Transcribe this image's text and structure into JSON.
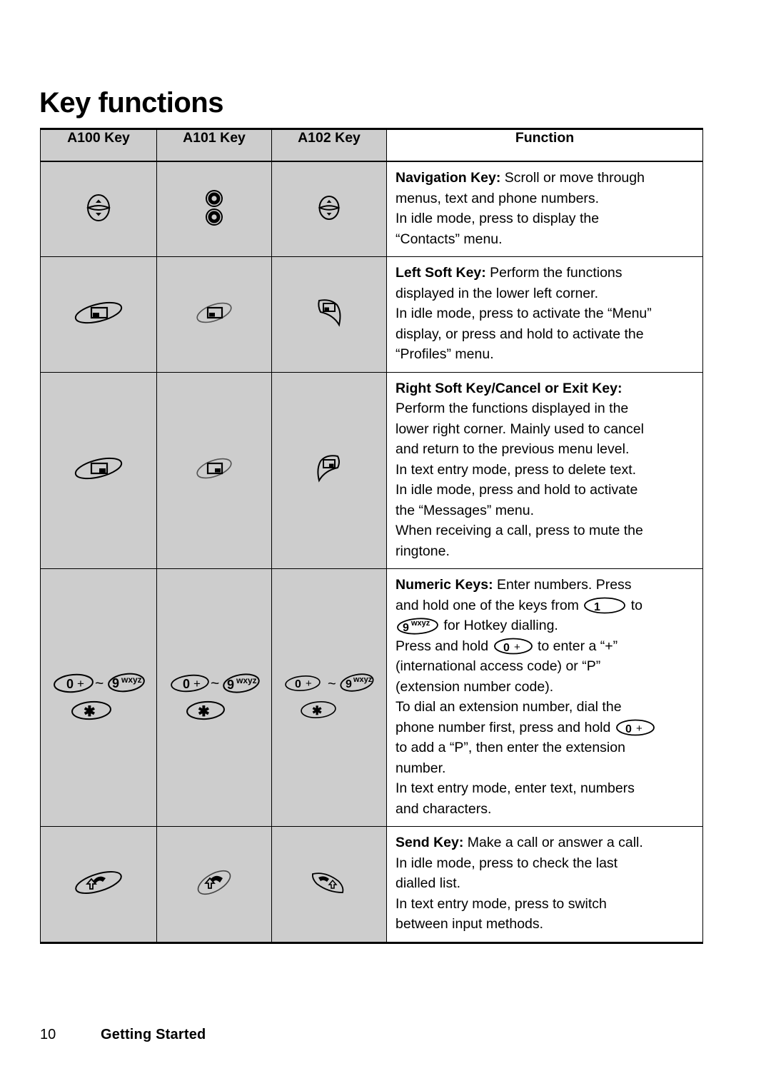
{
  "document": {
    "title": "Key functions",
    "footer": {
      "page_number": "10",
      "section": "Getting Started"
    }
  },
  "table": {
    "headers": {
      "a100": "A100 Key",
      "a101": "A101 Key",
      "a102": "A102 Key",
      "function": "Function"
    },
    "rows": [
      {
        "id": "navigation-key",
        "icons": {
          "a100": "navigation-key-oval-icon",
          "a101": "navigation-key-double-circle-icon",
          "a102": "navigation-key-oval-icon"
        },
        "function": {
          "bold": "Navigation Key:",
          "lines": [
            " Scroll or move through",
            "menus, text and phone numbers.",
            "In idle mode, press to display the",
            "“Contacts” menu."
          ]
        }
      },
      {
        "id": "left-soft-key",
        "icons": {
          "a100": "left-soft-key-ellipse-icon",
          "a101": "left-soft-key-ellipse-icon",
          "a102": "left-soft-key-leaf-icon"
        },
        "function": {
          "bold": "Left Soft Key:",
          "lines": [
            " Perform the functions",
            "displayed in the lower left corner.",
            "In idle mode, press to activate the “Menu”",
            "display, or press and hold to activate the",
            "“Profiles” menu."
          ]
        }
      },
      {
        "id": "right-soft-key",
        "icons": {
          "a100": "right-soft-key-ellipse-icon",
          "a101": "right-soft-key-ellipse-icon",
          "a102": "right-soft-key-leaf-icon"
        },
        "function": {
          "bold": "Right Soft Key/Cancel or Exit Key:",
          "lines": [
            "Perform the functions displayed in the",
            "lower right corner. Mainly used to cancel",
            "and return to the previous menu level.",
            "In text entry mode, press to delete text.",
            "In idle mode, press and hold to activate",
            "the “Messages” menu.",
            "When receiving a call, press to mute the",
            "ringtone."
          ]
        }
      },
      {
        "id": "numeric-keys",
        "icons": {
          "a100": "numeric-keys-group-icon",
          "a101": "numeric-keys-group-icon",
          "a102": "numeric-keys-group-icon"
        },
        "key_labels": {
          "zero": "0 +",
          "nine_digit": "9",
          "nine_letters": "wxyz",
          "one": "1",
          "star": "✱",
          "tilde": "~"
        },
        "function": {
          "bold": "Numeric Keys:",
          "segments": [
            "Enter numbers. Press",
            "and hold one of the keys from",
            "to",
            "for Hotkey dialling.",
            "Press and hold",
            "to enter a “+”",
            "(international access code) or “P”",
            "(extension number code).",
            "To dial an extension number, dial the",
            "phone number first, press and hold",
            "to add a “P”, then enter the extension",
            "number.",
            "In text entry mode, enter text, numbers",
            "and characters."
          ]
        }
      },
      {
        "id": "send-key",
        "icons": {
          "a100": "send-key-ellipse-icon",
          "a101": "send-key-ellipse-icon",
          "a102": "send-key-leaf-icon"
        },
        "function": {
          "bold": "Send Key:",
          "lines": [
            " Make a call or answer a call.",
            "In idle mode, press to check the last",
            "dialled list.",
            "In text entry mode, press to switch",
            "between input methods."
          ]
        }
      }
    ]
  },
  "colors": {
    "key_cell_background": "#cdcdcd",
    "border": "#000000",
    "text": "#000000",
    "page_background": "#ffffff"
  }
}
